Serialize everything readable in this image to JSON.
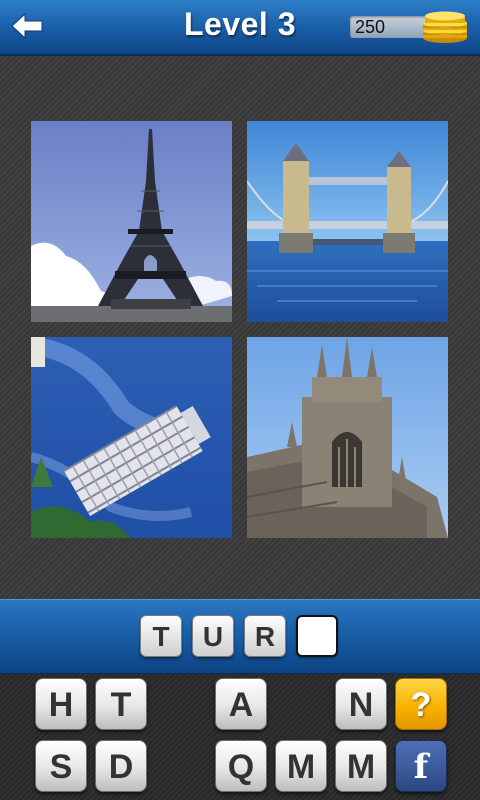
{
  "header": {
    "title": "Level 3",
    "coins": "250",
    "back_icon": "back-arrow-icon",
    "coin_icon": "coin-stack-icon",
    "accent_color": "#1a5fa8"
  },
  "pictures": [
    {
      "subject": "eiffel-tower"
    },
    {
      "subject": "tower-bridge"
    },
    {
      "subject": "leaning-tower-of-pisa"
    },
    {
      "subject": "gothic-tower"
    }
  ],
  "answer": {
    "letters": [
      "T",
      "U",
      "R",
      ""
    ]
  },
  "keyboard": {
    "row1": [
      "H",
      "T",
      "",
      "A",
      "",
      "N"
    ],
    "row2": [
      "S",
      "D",
      "",
      "Q",
      "M",
      "M"
    ],
    "hint_label": "?",
    "facebook_label": "f",
    "hint_color": "#f7b400",
    "facebook_color": "#3b5998"
  }
}
